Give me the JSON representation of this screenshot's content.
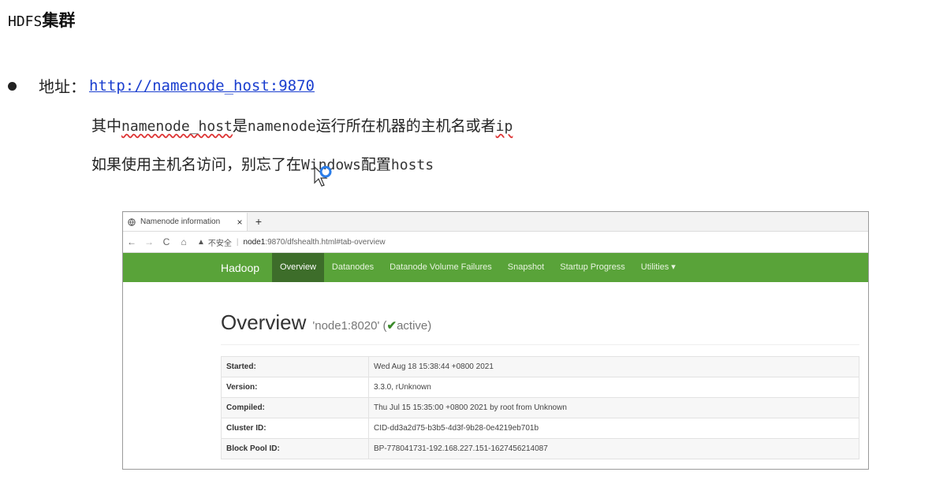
{
  "slide": {
    "title_prefix": "HDFS",
    "title_suffix": "集群",
    "address_label": "地址：",
    "address_link": "http://namenode_host:9870",
    "line1": {
      "a": "其中",
      "b": "namenode_host",
      "c": "是",
      "d": "namenode",
      "e": "运行所在机器的主机名或者",
      "f": "ip"
    },
    "line2": {
      "a": "如果使用主机名访问，别忘了在",
      "b": "Windows",
      "c": "配置",
      "d": "hosts"
    }
  },
  "browser": {
    "tab_title": "Namenode information",
    "tab_close": "×",
    "new_tab": "+",
    "nav": {
      "back": "←",
      "forward": "→",
      "reload": "C",
      "home": "⌂"
    },
    "security_label": "不安全",
    "url_host": "node1",
    "url_rest": ":9870/dfshealth.html#tab-overview"
  },
  "hadoop": {
    "brand": "Hadoop",
    "menu": [
      "Overview",
      "Datanodes",
      "Datanode Volume Failures",
      "Snapshot",
      "Startup Progress",
      "Utilities ▾"
    ],
    "overview_title": "Overview",
    "overview_node": "'node1:8020' (",
    "overview_status": "active)",
    "check": "✔",
    "info": [
      {
        "key": "Started:",
        "value": "Wed Aug 18 15:38:44 +0800 2021"
      },
      {
        "key": "Version:",
        "value": "3.3.0, rUnknown"
      },
      {
        "key": "Compiled:",
        "value": "Thu Jul 15 15:35:00 +0800 2021 by root from Unknown"
      },
      {
        "key": "Cluster ID:",
        "value": "CID-dd3a2d75-b3b5-4d3f-9b28-0e4219eb701b"
      },
      {
        "key": "Block Pool ID:",
        "value": "BP-778041731-192.168.227.151-1627456214087"
      }
    ]
  },
  "colors": {
    "accent": "#59a339",
    "active_nav": "#3d6d2a",
    "link": "#1a3ecf"
  }
}
